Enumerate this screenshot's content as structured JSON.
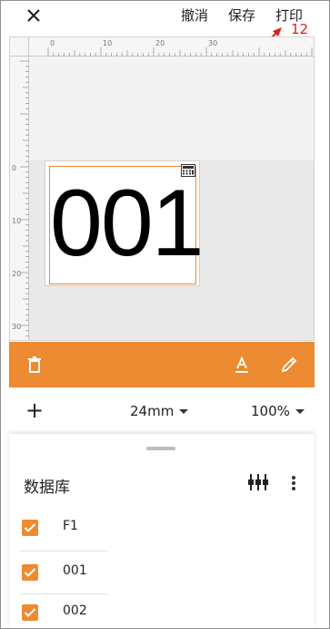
{
  "topbar": {
    "close_icon": "close-icon",
    "undo_label": "撤消",
    "save_label": "保存",
    "print_label": "打印"
  },
  "annotation": {
    "number": "12",
    "color": "#e0201b"
  },
  "ruler": {
    "top_labels": [
      "0",
      "10",
      "20",
      "30"
    ],
    "left_labels": [
      "0",
      "10",
      "20",
      "30"
    ]
  },
  "label": {
    "text": "001",
    "border_color": "#e8893a",
    "corner_icon": "calculator-icon"
  },
  "toolbar": {
    "color": "#ec8b32",
    "icons": [
      "trash-icon",
      "text-format-icon",
      "pencil-icon"
    ]
  },
  "size_bar": {
    "add_icon": "+",
    "size_value": "24mm",
    "zoom_value": "100%"
  },
  "database": {
    "title": "数据库",
    "columns_icon": "column-settings-icon",
    "more_icon": "more-vertical-icon",
    "rows": [
      {
        "label": "F1",
        "checked": true
      },
      {
        "label": "001",
        "checked": true
      },
      {
        "label": "002",
        "checked": true
      }
    ]
  }
}
